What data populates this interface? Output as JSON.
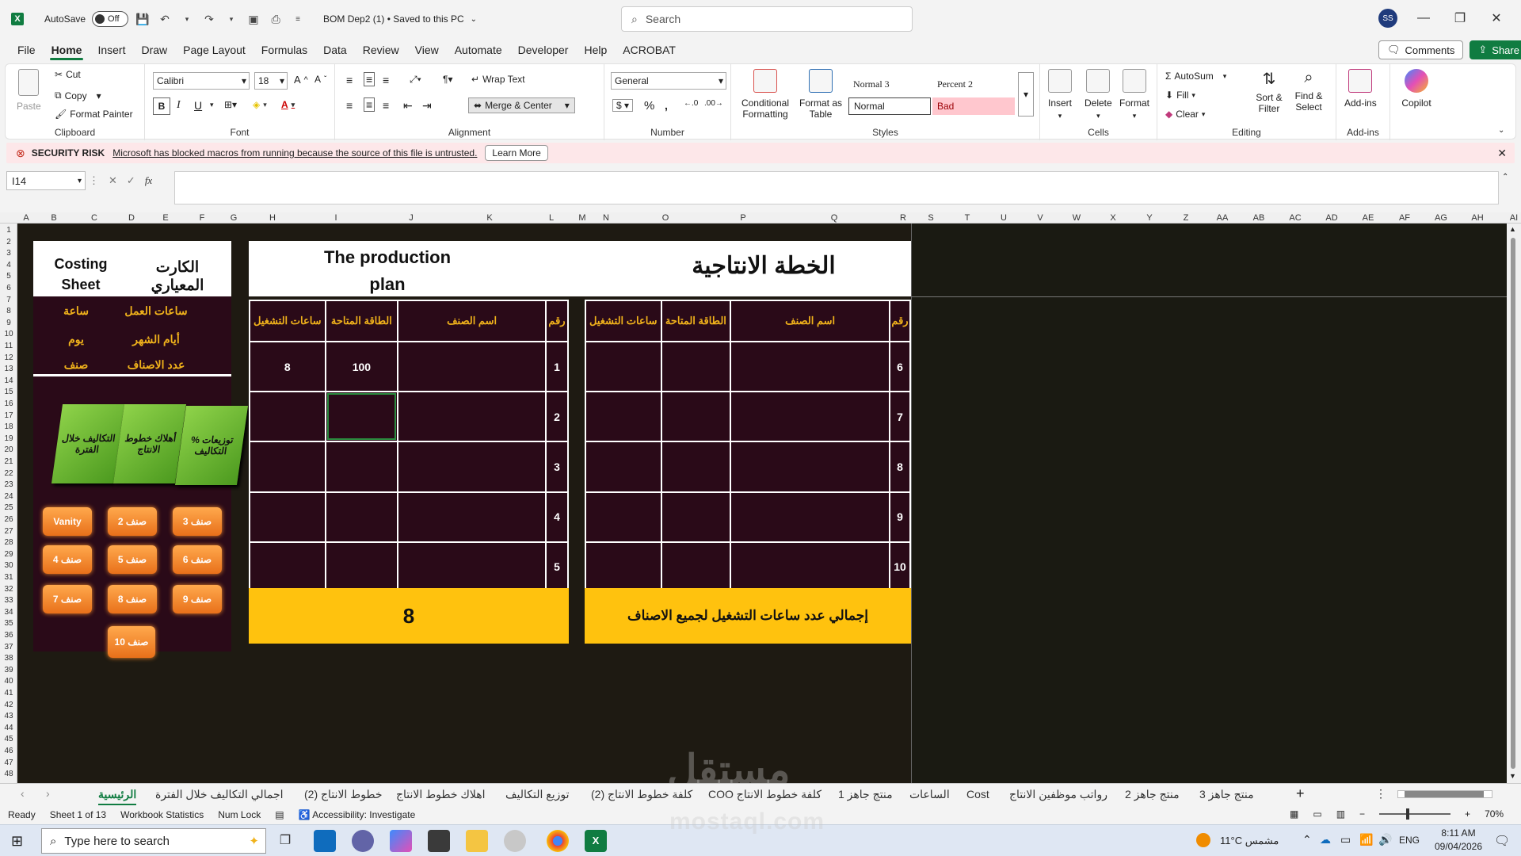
{
  "titlebar": {
    "autosave_label": "AutoSave",
    "autosave_state": "Off",
    "doc_title": "BOM Dep2 (1) • Saved to this PC",
    "search_placeholder": "Search",
    "user_initials": "SS"
  },
  "menu": {
    "tabs": [
      "File",
      "Home",
      "Insert",
      "Draw",
      "Page Layout",
      "Formulas",
      "Data",
      "Review",
      "View",
      "Automate",
      "Developer",
      "Help",
      "ACROBAT"
    ],
    "active": "Home",
    "comments": "Comments",
    "share": "Share"
  },
  "ribbon": {
    "clipboard": {
      "paste": "Paste",
      "cut": "Cut",
      "copy": "Copy",
      "format_painter": "Format Painter",
      "label": "Clipboard"
    },
    "font": {
      "name": "Calibri",
      "size": "18",
      "label": "Font"
    },
    "alignment": {
      "wrap": "Wrap Text",
      "merge": "Merge & Center",
      "label": "Alignment"
    },
    "number": {
      "format": "General",
      "label": "Number"
    },
    "styles": {
      "conditional": "Conditional Formatting",
      "format_table": "Format as Table",
      "normal3": "Normal 3",
      "percent2": "Percent 2",
      "normal": "Normal",
      "bad": "Bad",
      "label": "Styles"
    },
    "cells": {
      "insert": "Insert",
      "delete": "Delete",
      "format": "Format",
      "label": "Cells"
    },
    "editing": {
      "autosum": "AutoSum",
      "fill": "Fill",
      "clear": "Clear",
      "sort": "Sort & Filter",
      "find": "Find & Select",
      "label": "Editing"
    },
    "addins": {
      "addins": "Add-ins",
      "label": "Add-ins"
    },
    "copilot": "Copilot"
  },
  "security": {
    "title": "SECURITY RISK",
    "message": "Microsoft has blocked macros from running because the source of this file is untrusted.",
    "button": "Learn More"
  },
  "formula": {
    "namebox": "I14",
    "fx": "fx",
    "value": ""
  },
  "columns": [
    "A",
    "B",
    "C",
    "D",
    "E",
    "F",
    "G",
    "H",
    "I",
    "J",
    "K",
    "L",
    "M",
    "N",
    "O",
    "P",
    "Q",
    "R",
    "S",
    "T",
    "U",
    "V",
    "W",
    "X",
    "Y",
    "Z",
    "AA",
    "AB",
    "AC",
    "AD",
    "AE",
    "AF",
    "AG",
    "AH",
    "AI"
  ],
  "rows": [
    "1",
    "2",
    "3",
    "4",
    "5",
    "6",
    "7",
    "8",
    "9",
    "10",
    "11",
    "12",
    "13",
    "14",
    "15",
    "16",
    "17",
    "18",
    "19",
    "20",
    "21",
    "22",
    "23",
    "24",
    "25",
    "26",
    "27",
    "28",
    "29",
    "30",
    "31",
    "32",
    "33",
    "34",
    "35",
    "36",
    "37",
    "38",
    "39",
    "40",
    "41",
    "42",
    "43",
    "44",
    "45",
    "46",
    "47",
    "48"
  ],
  "dashboard": {
    "costing_en": "Costing Sheet",
    "costing_ar": "الكارت المعياري",
    "side_rows": [
      {
        "ar": "ساعات العمل",
        "unit": "ساعة"
      },
      {
        "ar": "أيام الشهر",
        "unit": "يوم"
      },
      {
        "ar": "عدد الاصناف",
        "unit": "صنف"
      }
    ],
    "green_buttons": [
      "توزيعات % التكاليف",
      "أهلاك خطوط الانتاج",
      "التكاليف خلال الفترة"
    ],
    "orange_buttons": [
      "صنف 3",
      "صنف 2",
      "Vanity",
      "صنف 6",
      "صنف 5",
      "صنف 4",
      "صنف 9",
      "صنف 8",
      "صنف 7",
      "صنف 10"
    ],
    "plan_en": "The production plan",
    "plan_ar": "الخطة الانتاجية",
    "headers": [
      "رقم",
      "اسم الصنف",
      "الطاقة المتاحة",
      "ساعات التشغيل"
    ],
    "left_table": [
      {
        "num": "1",
        "name": "",
        "capacity": "100",
        "hours": "8"
      },
      {
        "num": "2",
        "name": "",
        "capacity": "",
        "hours": ""
      },
      {
        "num": "3",
        "name": "",
        "capacity": "",
        "hours": ""
      },
      {
        "num": "4",
        "name": "",
        "capacity": "",
        "hours": ""
      },
      {
        "num": "5",
        "name": "",
        "capacity": "",
        "hours": ""
      }
    ],
    "right_table": [
      {
        "num": "6",
        "name": "",
        "capacity": "",
        "hours": ""
      },
      {
        "num": "7",
        "name": "",
        "capacity": "",
        "hours": ""
      },
      {
        "num": "8",
        "name": "",
        "capacity": "",
        "hours": ""
      },
      {
        "num": "9",
        "name": "",
        "capacity": "",
        "hours": ""
      },
      {
        "num": "10",
        "name": "",
        "capacity": "",
        "hours": ""
      }
    ],
    "total_value": "8",
    "total_label": "إجمالي عدد ساعات التشغيل لجميع الاصناف"
  },
  "sheet_tabs": [
    "الرئيسية",
    "اجمالي التكاليف خلال الفترة",
    "خطوط الانتاج (2)",
    "اهلاك خطوط الانتاج",
    "توزيع التكاليف",
    "كلفة خطوط الانتاج (2)",
    "COO كلفة خطوط الانتاج",
    "منتج جاهز 1",
    "الساعات",
    "Cost",
    "رواتب موظفين الانتاج",
    "منتج جاهز 2",
    "منتج جاهز 3"
  ],
  "active_sheet": "الرئيسية",
  "status": {
    "ready": "Ready",
    "sheet": "Sheet 1 of 13",
    "stats": "Workbook Statistics",
    "numlock": "Num Lock",
    "accessibility": "Accessibility: Investigate",
    "zoom": "70%"
  },
  "taskbar": {
    "search": "Type here to search",
    "weather": "11°C مشمس",
    "lang": "ENG",
    "time": "8:11 AM",
    "date": "09/04/2026"
  },
  "watermark": {
    "ar": "مستقل",
    "en": "mostaql.com"
  }
}
